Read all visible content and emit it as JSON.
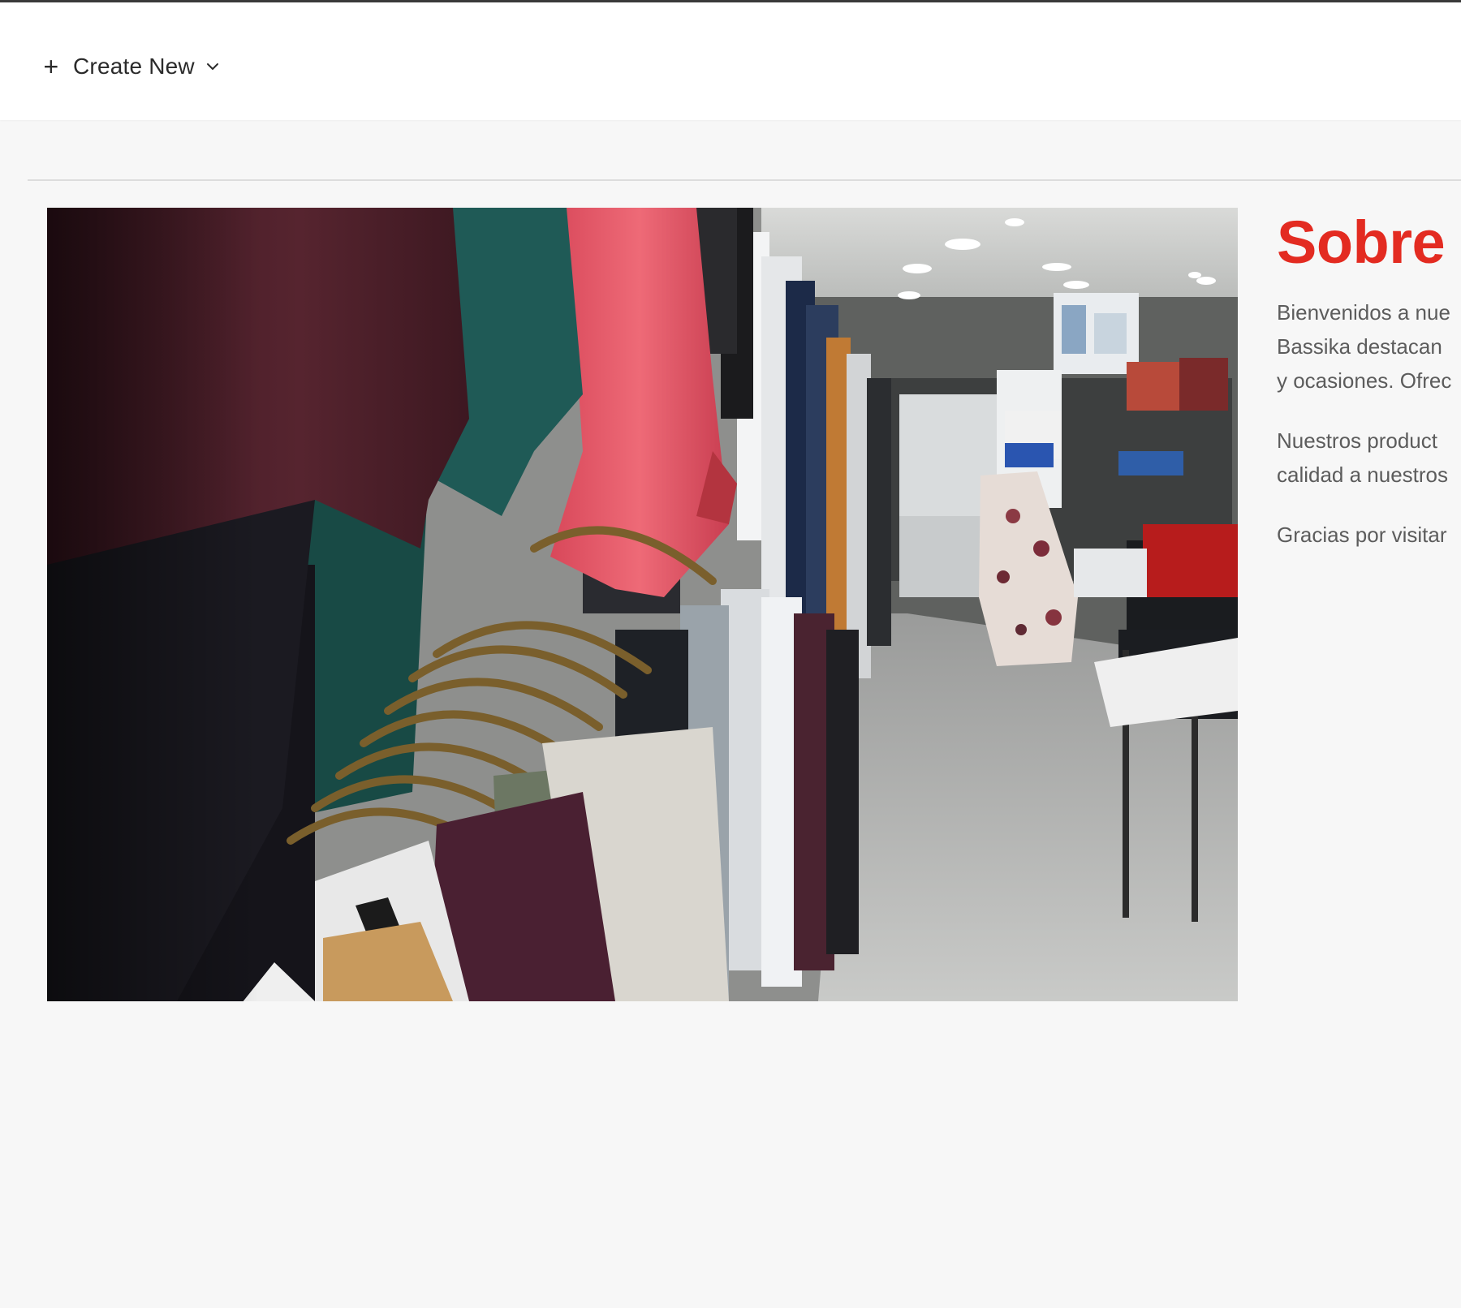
{
  "toolbar": {
    "create_new_label": "Create New",
    "plus_icon": "plus-icon",
    "dropdown_icon": "chevron-down-icon"
  },
  "hero_image": {
    "subject": "clothing-store-racks"
  },
  "about": {
    "title_accent": "Sobre",
    "title_rest": "",
    "paragraph_1_lines": [
      "Bienvenidos a nue",
      "Bassika destacan",
      "y ocasiones. Ofrec"
    ],
    "paragraph_2_lines": [
      "Nuestros product",
      "calidad a nuestros"
    ],
    "paragraph_3_lines": [
      "Gracias por visitar"
    ]
  },
  "colors": {
    "accent": "#e32b21",
    "text": "#5c5c5c",
    "page_bg": "#f7f7f7",
    "topbar_bg": "#ffffff"
  }
}
